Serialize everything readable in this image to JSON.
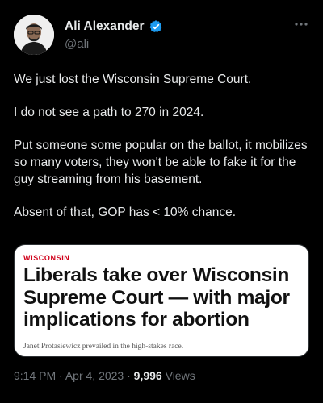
{
  "author": {
    "name": "Ali Alexander",
    "handle": "@ali",
    "verified_color": "#1d9bf0"
  },
  "icons": {
    "verified": "verified-badge-icon",
    "more": "more-options-icon"
  },
  "tweet": {
    "paragraphs": [
      "We just lost the Wisconsin Supreme Court.",
      "I do not see a path to 270 in 2024.",
      "Put someone some popular on the ballot, it mobilizes so many voters, they won't be able to fake it for the guy streaming from his basement.",
      "Absent of that, GOP has < 10% chance."
    ]
  },
  "card": {
    "kicker": "WISCONSIN",
    "headline": "Liberals take over Wisconsin Supreme Court — with major implications for abortion",
    "dek": "Janet Protasiewicz prevailed in the high-stakes race.",
    "kicker_color": "#d0021b"
  },
  "meta": {
    "time": "9:14 PM",
    "separator": "·",
    "date": "Apr 4, 2023",
    "views_count": "9,996",
    "views_label": "Views"
  }
}
